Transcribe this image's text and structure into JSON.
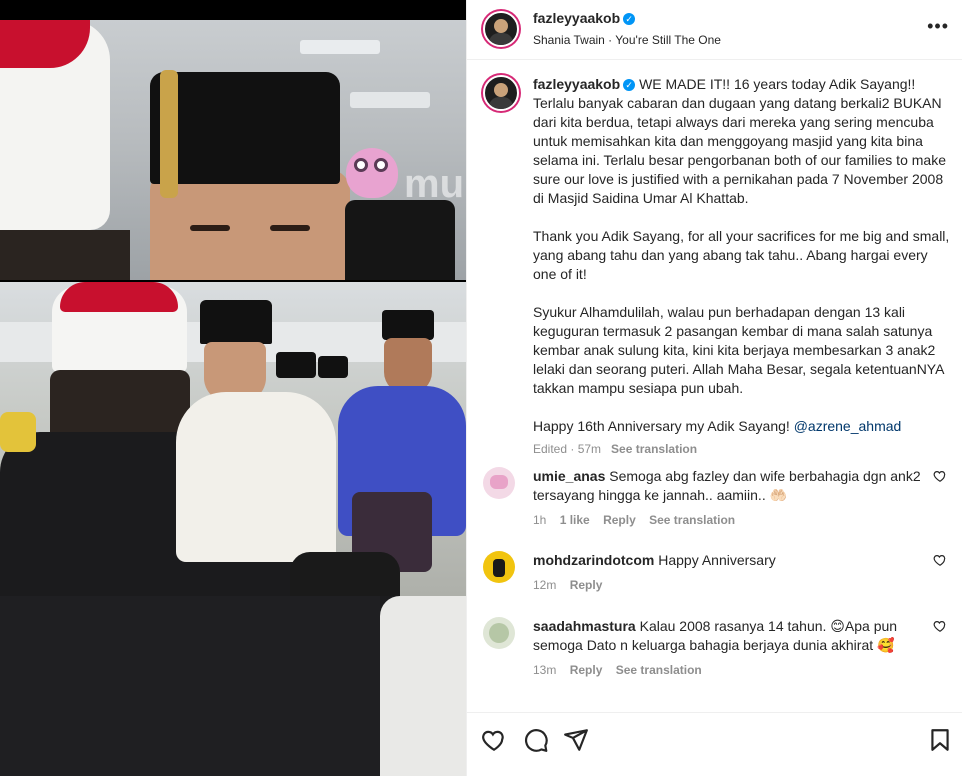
{
  "post": {
    "username": "fazleyyaakob",
    "verified_symbol": "✓",
    "song": "Shania Twain · You're Still The One",
    "more_label": "•••"
  },
  "watermark_text": "murai",
  "caption": {
    "username": "fazleyyaakob",
    "body": "WE MADE IT!! 16 years today Adik Sayang!!\nTerlalu banyak cabaran dan dugaan yang datang berkali2 BUKAN dari kita berdua, tetapi always dari mereka yang sering mencuba untuk memisahkan kita dan menggoyang masjid yang kita bina selama ini. Terlalu besar pengorbanan both of our families to make sure our love is justified with a pernikahan pada 7 November 2008 di Masjid Saidina Umar Al Khattab.\n\nThank you Adik Sayang, for all your sacrifices for me big and small, yang abang tahu dan yang abang tak tahu.. Abang hargai every one of it!\n\nSyukur Alhamdulilah, walau pun berhadapan dengan 13 kali keguguran termasuk 2 pasangan kembar di mana salah satunya kembar anak sulung kita, kini kita berjaya membesarkan 3 anak2 lelaki dan seorang puteri. Allah Maha Besar, segala ketentuanNYA takkan mampu sesiapa pun ubah.\n\nHappy 16th Anniversary my Adik Sayang! ",
    "mention": "@azrene_ahmad",
    "edited": "Edited · 57m",
    "see_translation": "See translation"
  },
  "comments": [
    {
      "username": "umie_anas",
      "text": "Semoga abg fazley dan wife berbahagia dgn ank2 tersayang hingga ke jannah.. aamiin.. 🤲🏻",
      "time": "1h",
      "likes": "1 like",
      "reply": "Reply",
      "see_translation": "See translation"
    },
    {
      "username": "mohdzarindotcom",
      "text": "Happy Anniversary",
      "time": "12m",
      "reply": "Reply"
    },
    {
      "username": "saadahmastura",
      "text": "Kalau 2008 rasanya 14 tahun. 😊Apa pun semoga Dato n keluarga bahagia berjaya dunia akhirat 🥰",
      "time": "13m",
      "reply": "Reply",
      "see_translation": "See translation"
    }
  ],
  "colors": {
    "story_ring": "#d62976",
    "verified": "#0095f6",
    "mention": "#00376b",
    "muted": "#8e8e8e"
  },
  "icons": [
    "heart-icon",
    "comment-icon",
    "share-icon",
    "bookmark-icon",
    "more-icon"
  ]
}
